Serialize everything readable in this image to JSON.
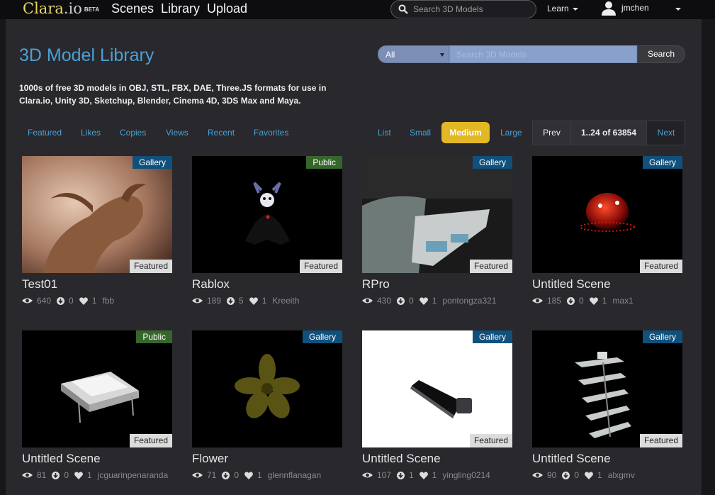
{
  "brand": {
    "name": "Clara",
    "suffix": ".io",
    "tag": "BETA"
  },
  "topnav": [
    "Scenes",
    "Library",
    "Upload"
  ],
  "top_search": {
    "placeholder": "Search 3D Models"
  },
  "learn_menu": "Learn",
  "user": {
    "name": "jmchen"
  },
  "page": {
    "title": "3D Model Library",
    "description": "1000s of free 3D models in OBJ, STL, FBX, DAE, Three.JS formats for use in Clara.io, Unity 3D, Sketchup, Blender, Cinema 4D, 3DS Max and Maya."
  },
  "library_search": {
    "category": "All",
    "placeholder": "Search 3D Models",
    "button": "Search"
  },
  "sort_tabs": [
    "Featured",
    "Likes",
    "Copies",
    "Views",
    "Recent",
    "Favorites"
  ],
  "view_tabs": [
    "List",
    "Small",
    "Medium",
    "Large"
  ],
  "active_view": "Medium",
  "pager": {
    "prev": "Prev",
    "info": "1..24 of 63854",
    "next": "Next"
  },
  "featured_label": "Featured",
  "cards": [
    {
      "title": "Test01",
      "badge": "Gallery",
      "views": "640",
      "copies": "0",
      "likes": "1",
      "author": "fbb"
    },
    {
      "title": "Rablox",
      "badge": "Public",
      "views": "189",
      "copies": "5",
      "likes": "1",
      "author": "Kreeith"
    },
    {
      "title": "RPro",
      "badge": "Gallery",
      "views": "430",
      "copies": "0",
      "likes": "1",
      "author": "pontongza321"
    },
    {
      "title": "Untitled Scene",
      "badge": "Gallery",
      "views": "185",
      "copies": "0",
      "likes": "1",
      "author": "max1"
    },
    {
      "title": "Untitled Scene",
      "badge": "Public",
      "views": "81",
      "copies": "0",
      "likes": "1",
      "author": "jcguarinpenaranda"
    },
    {
      "title": "Flower",
      "badge": "Gallery",
      "views": "71",
      "copies": "0",
      "likes": "1",
      "author": "glennflanagan"
    },
    {
      "title": "Untitled Scene",
      "badge": "Gallery",
      "views": "107",
      "copies": "1",
      "likes": "1",
      "author": "yingling0214"
    },
    {
      "title": "Untitled Scene",
      "badge": "Gallery",
      "views": "90",
      "copies": "0",
      "likes": "1",
      "author": "alxgmv"
    }
  ],
  "colors": {
    "accent": "#4aa0d6",
    "gallery_badge": "#10507c",
    "public_badge": "#36662b",
    "active_view": "#e3b825"
  },
  "icons": {
    "views": "eye-icon",
    "copies": "download-icon",
    "likes": "heart-icon"
  }
}
